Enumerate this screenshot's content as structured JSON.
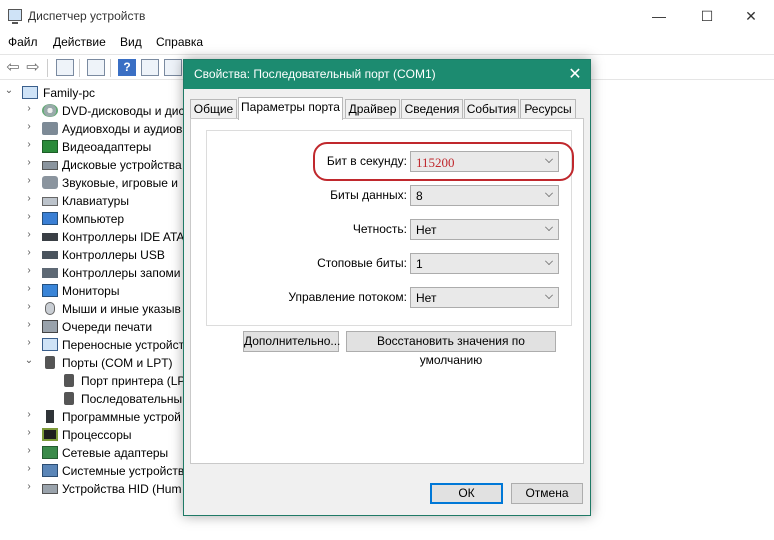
{
  "main_window": {
    "title": "Диспетчер устройств",
    "controls": {
      "minimize": "—",
      "maximize": "☐",
      "close": "✕"
    },
    "menu": [
      "Файл",
      "Действие",
      "Вид",
      "Справка"
    ],
    "toolbar": {
      "back": "⇦",
      "forward": "⇨",
      "help": "?"
    },
    "tree": {
      "root": "Family-pc",
      "items": [
        "DVD-дисководы и дис",
        "Аудиовходы и аудиов",
        "Видеоадаптеры",
        "Дисковые устройства",
        "Звуковые, игровые и",
        "Клавиатуры",
        "Компьютер",
        "Контроллеры IDE ATA",
        "Контроллеры USB",
        "Контроллеры запоми",
        "Мониторы",
        "Мыши и иные указыв",
        "Очереди печати",
        "Переносные устройст",
        "Порты (COM и LPT)",
        "Порт принтера (LP",
        "Последовательны",
        "Программные устрой",
        "Процессоры",
        "Сетевые адаптеры",
        "Системные устройств",
        "Устройства HID (Hum"
      ],
      "chevron_collapsed": "›",
      "chevron_expanded": "⌄"
    }
  },
  "dialog": {
    "title": "Свойства: Последовательный порт (COM1)",
    "close": "✕",
    "tabs": [
      "Общие",
      "Параметры порта",
      "Драйвер",
      "Сведения",
      "События",
      "Ресурсы"
    ],
    "active_tab": "Параметры порта",
    "fields": [
      {
        "label": "Бит в секунду:",
        "value": "115200"
      },
      {
        "label": "Биты данных:",
        "value": "8"
      },
      {
        "label": "Четность:",
        "value": "Нет"
      },
      {
        "label": "Стоповые биты:",
        "value": "1"
      },
      {
        "label": "Управление потоком:",
        "value": "Нет"
      }
    ],
    "buttons": {
      "advanced": "Дополнительно...",
      "restore": "Восстановить значения по умолчанию",
      "ok": "ОК",
      "cancel": "Отмена"
    },
    "highlight_color": "#c0282d",
    "title_bar_color": "#1c8b70"
  }
}
